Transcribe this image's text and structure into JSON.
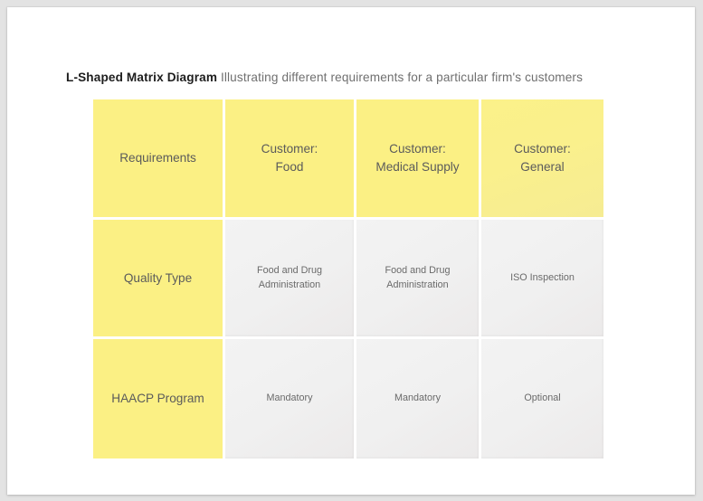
{
  "page": {
    "background_color": "#e3e3e3",
    "canvas_color": "#ffffff"
  },
  "title": {
    "strong": "L-Shaped Matrix Diagram",
    "rest": " Illustrating different requirements for a particular firm's customers"
  },
  "colors": {
    "header_yellow": "#fbf084",
    "header_yellow_faded": "#f6ec93",
    "cell_grey": "#f0f0f0",
    "label_text": "#5b5b5b",
    "cell_text": "#6a6a6a",
    "title_strong_text": "#1d1d1d",
    "title_rest_text": "#6f6f6f"
  },
  "matrix": {
    "type": "l-shaped-matrix",
    "columns": [
      "Requirements",
      "Customer:\nFood",
      "Customer:\nMedical Supply",
      "Customer:\nGeneral"
    ],
    "header": [
      {
        "line1": "Requirements",
        "line2": ""
      },
      {
        "line1": "Customer:",
        "line2": "Food"
      },
      {
        "line1": "Customer:",
        "line2": "Medical Supply"
      },
      {
        "line1": "Customer:",
        "line2": "General"
      }
    ],
    "rows": [
      {
        "label": "Quality Type",
        "cells": [
          {
            "line1": "Food and Drug",
            "line2": "Administration"
          },
          {
            "line1": "Food and Drug",
            "line2": "Administration"
          },
          {
            "line1": "ISO Inspection",
            "line2": ""
          }
        ]
      },
      {
        "label": "HAACP Program",
        "cells": [
          {
            "line1": "Mandatory",
            "line2": ""
          },
          {
            "line1": "Mandatory",
            "line2": ""
          },
          {
            "line1": "Optional",
            "line2": ""
          }
        ]
      }
    ]
  }
}
